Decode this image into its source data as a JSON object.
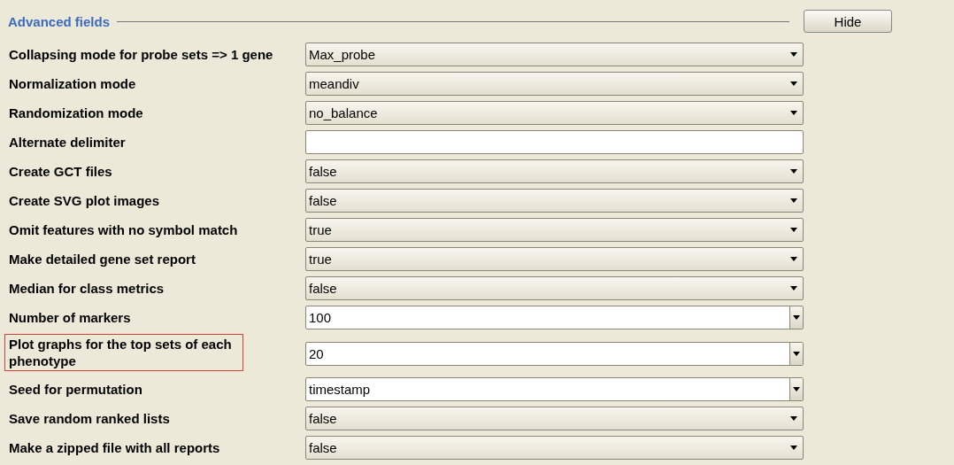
{
  "section": {
    "title": "Advanced fields",
    "toggle_button": "Hide"
  },
  "fields": [
    {
      "label": "Collapsing mode for probe sets => 1 gene",
      "kind": "select",
      "value": "Max_probe",
      "highlighted": false
    },
    {
      "label": "Normalization mode",
      "kind": "select",
      "value": "meandiv",
      "highlighted": false
    },
    {
      "label": "Randomization mode",
      "kind": "select",
      "value": "no_balance",
      "highlighted": false
    },
    {
      "label": "Alternate delimiter",
      "kind": "text",
      "highlighted": false
    },
    {
      "label": "Create GCT files",
      "kind": "select",
      "value": "false",
      "highlighted": false
    },
    {
      "label": "Create SVG plot images",
      "kind": "select",
      "value": "false",
      "highlighted": false
    },
    {
      "label": "Omit features with no symbol match",
      "kind": "select",
      "value": "true",
      "highlighted": false
    },
    {
      "label": "Make detailed gene set report",
      "kind": "select",
      "value": "true",
      "highlighted": false
    },
    {
      "label": "Median for class metrics",
      "kind": "select",
      "value": "false",
      "highlighted": false
    },
    {
      "label": "Number of markers",
      "kind": "combo",
      "value": "100",
      "highlighted": false
    },
    {
      "label": "Plot graphs for the top sets of each phenotype",
      "kind": "combo",
      "value": "20",
      "highlighted": true
    },
    {
      "label": "Seed for permutation",
      "kind": "combo",
      "value": "timestamp",
      "highlighted": false
    },
    {
      "label": "Save random ranked lists",
      "kind": "select",
      "value": "false",
      "highlighted": false
    },
    {
      "label": "Make a zipped file with all reports",
      "kind": "select",
      "value": "false",
      "highlighted": false
    }
  ]
}
